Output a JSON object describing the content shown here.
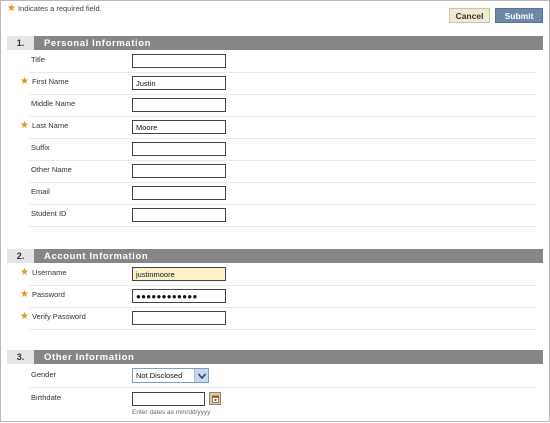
{
  "header": {
    "required_note": "Indicates a required field.",
    "cancel_label": "Cancel",
    "submit_label": "Submit"
  },
  "sections": [
    {
      "number": "1.",
      "title": "Personal Information",
      "fields": [
        {
          "label": "Title",
          "value": "",
          "required": false
        },
        {
          "label": "First Name",
          "value": "Justin",
          "required": true
        },
        {
          "label": "Middle Name",
          "value": "",
          "required": false
        },
        {
          "label": "Last Name",
          "value": "Moore",
          "required": true
        },
        {
          "label": "Suffix",
          "value": "",
          "required": false
        },
        {
          "label": "Other Name",
          "value": "",
          "required": false
        },
        {
          "label": "Email",
          "value": "",
          "required": false
        },
        {
          "label": "Student ID",
          "value": "",
          "required": false
        }
      ]
    },
    {
      "number": "2.",
      "title": "Account Information",
      "fields": [
        {
          "label": "Username",
          "value": "justinmoore",
          "required": true
        },
        {
          "label": "Password",
          "value": "●●●●●●●●●●●●",
          "required": true
        },
        {
          "label": "Verify Password",
          "value": "",
          "required": true
        }
      ]
    },
    {
      "number": "3.",
      "title": "Other Information",
      "fields": [
        {
          "label": "Gender",
          "value": "Not Disclosed",
          "required": false
        },
        {
          "label": "Birthdate",
          "value": "",
          "required": false,
          "hint": "Enter dates as mm/dd/yyyy"
        }
      ]
    }
  ],
  "colors": {
    "required_star": "#e8931a",
    "section_bar": "#868686",
    "submit_button": "#6d87a8",
    "cancel_button": "#f0ead0",
    "focused_field": "#fbf2c9"
  },
  "icons": [
    "required-star-icon",
    "dropdown-arrow-icon",
    "calendar-icon"
  ]
}
